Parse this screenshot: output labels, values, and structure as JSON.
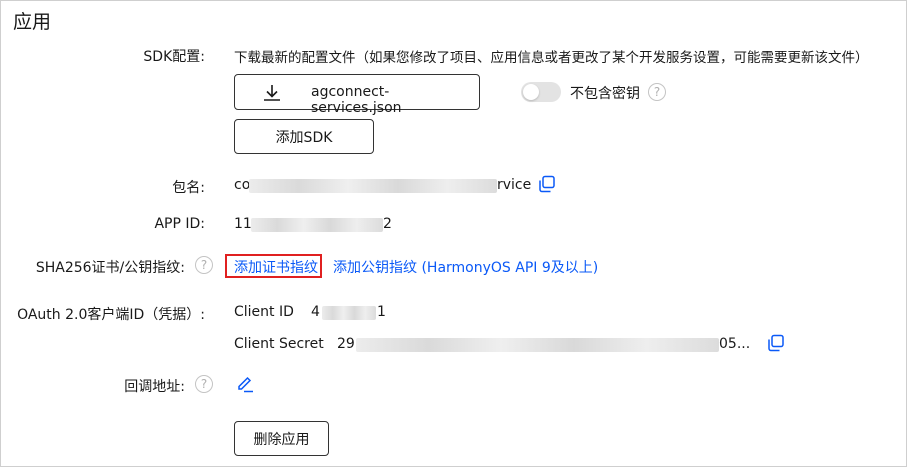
{
  "section": {
    "title": "应用"
  },
  "sdk": {
    "label": "SDK配置:",
    "description": "下载最新的配置文件（如果您修改了项目、应用信息或者更改了某个开发服务设置，可能需要更新该文件）",
    "download_filename": "agconnect-services.json",
    "toggle_label": "不包含密钥",
    "toggle_on": false,
    "add_sdk_label": "添加SDK"
  },
  "package": {
    "label": "包名:",
    "prefix": "co",
    "suffix": "rvice"
  },
  "app_id": {
    "label": "APP ID:",
    "prefix": "11",
    "suffix": "2"
  },
  "sha256": {
    "label": "SHA256证书/公钥指纹:",
    "add_cert_link": "添加证书指纹",
    "add_pubkey_link": "添加公钥指纹 (HarmonyOS API 9及以上)"
  },
  "oauth": {
    "label": "OAuth 2.0客户端ID（凭据）:",
    "client_id_label": "Client ID",
    "client_id_prefix": "4",
    "client_id_suffix": "1",
    "client_secret_label": "Client Secret",
    "client_secret_prefix": "29",
    "client_secret_suffix": "05..."
  },
  "callback": {
    "label": "回调地址:"
  },
  "delete_app_label": "删除应用",
  "colors": {
    "link": "#0a59f7",
    "highlight_border": "#e02020",
    "icon_blue": "#0a59f7"
  },
  "icons": [
    "download-icon",
    "copy-icon",
    "help-icon",
    "edit-icon"
  ]
}
